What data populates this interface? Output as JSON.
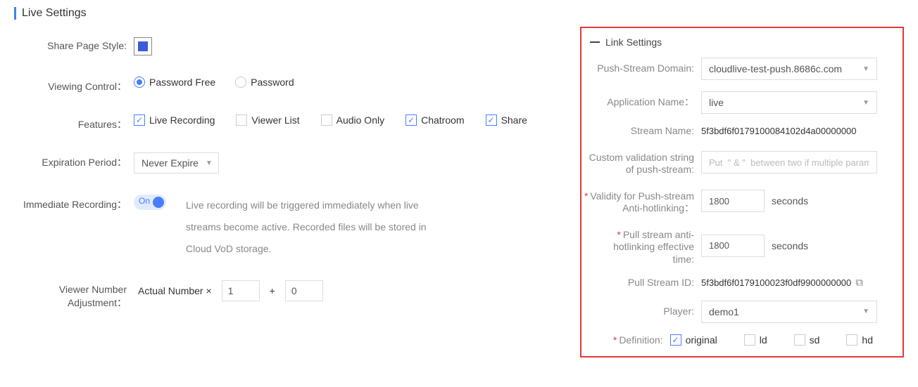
{
  "section_title": "Live Settings",
  "labels": {
    "share_page_style": "Share Page Style:",
    "viewing_control": "Viewing Control：",
    "features": "Features：",
    "expiration_period": "Expiration Period：",
    "immediate_recording": "Immediate Recording：",
    "viewer_num_adj_l1": "Viewer Number",
    "viewer_num_adj_l2": "Adjustment：",
    "actual_x": "Actual Number ×",
    "plus": "+"
  },
  "viewing_control": {
    "password_free": "Password Free",
    "password": "Password"
  },
  "features": {
    "live_recording": "Live Recording",
    "viewer_list": "Viewer List",
    "audio_only": "Audio Only",
    "chatroom": "Chatroom",
    "share": "Share"
  },
  "expiration_value": "Never Expire",
  "toggle_on": "On",
  "recording_hint": "Live recording will be triggered immediately when live streams become active. Recorded files will be stored in Cloud VoD storage.",
  "viewer_mult": "1",
  "viewer_add": "0",
  "link": {
    "legend": "Link Settings",
    "push_domain_label": "Push-Stream Domain:",
    "push_domain_value": "cloudlive-test-push.8686c.com",
    "app_name_label": "Application Name：",
    "app_name_value": "live",
    "stream_name_label": "Stream Name:",
    "stream_name_value": "5f3bdf6f0179100084102d4a00000000",
    "custom_val_l1": "Custom validation string",
    "custom_val_l2": "of push-stream:",
    "custom_val_placeholder": "Put  \" & \"  between two if multiple paramet",
    "push_anti_l1": "Validity for Push-stream",
    "push_anti_l2": "Anti-hotlinking：",
    "push_anti_value": "1800",
    "pull_anti_l1": "Pull stream anti-",
    "pull_anti_l2": "hotlinking effective",
    "pull_anti_l3": "time:",
    "pull_anti_value": "1800",
    "seconds": "seconds",
    "pull_id_label": "Pull Stream ID:",
    "pull_id_value": "5f3bdf6f0179100023f0df9900000000",
    "player_label": "Player:",
    "player_value": "demo1",
    "definition_label": "Definition:",
    "def_original": "original",
    "def_ld": "ld",
    "def_sd": "sd",
    "def_hd": "hd"
  }
}
